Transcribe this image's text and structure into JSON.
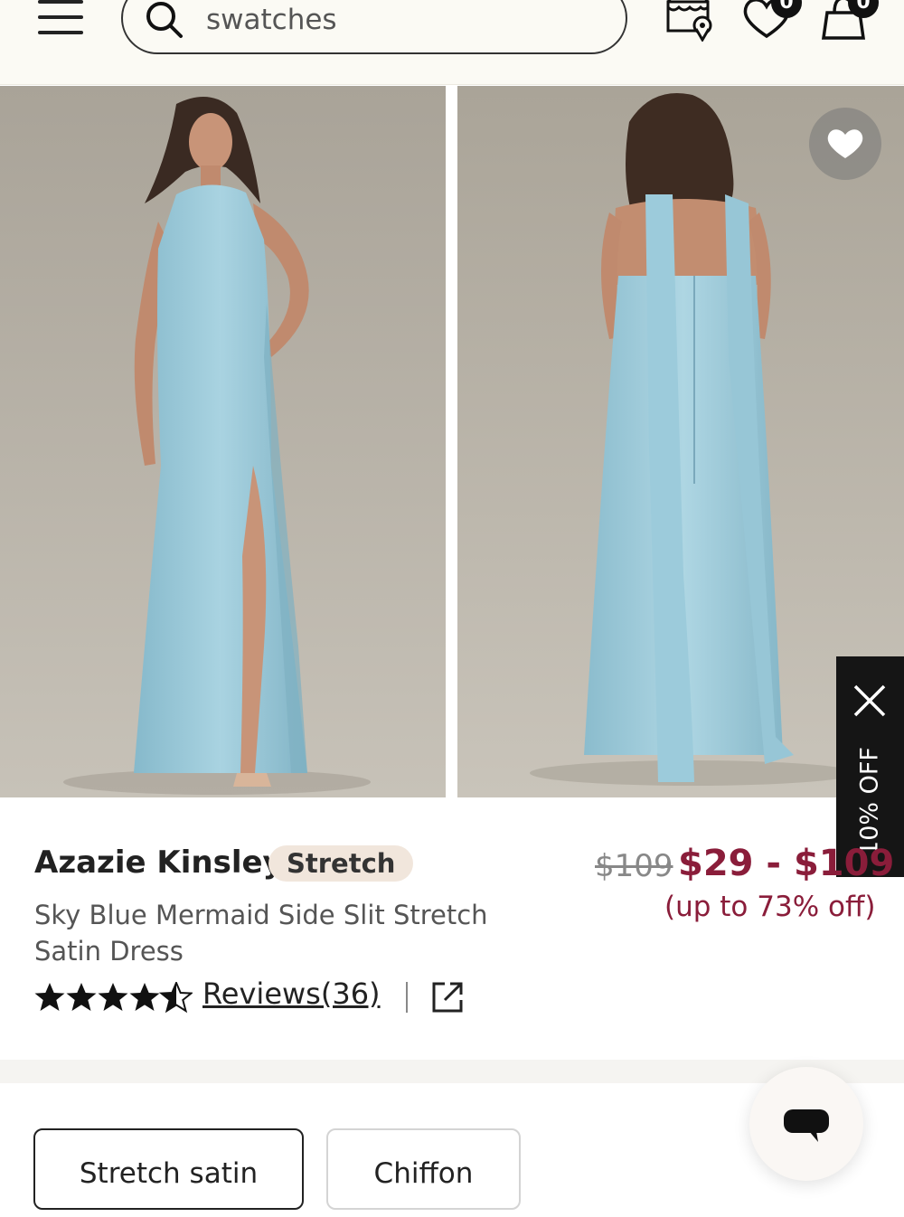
{
  "header": {
    "search_placeholder": "swatches",
    "wishlist_count": "0",
    "cart_count": "0",
    "icons": [
      "menu-icon",
      "search-icon",
      "store-locator-icon",
      "heart-icon",
      "bag-icon"
    ]
  },
  "gallery": {
    "images": [
      {
        "alt": "Front view of sky blue halter satin dress"
      },
      {
        "alt": "Back view of sky blue dress with scarf"
      }
    ]
  },
  "promo": {
    "label": "10% OFF"
  },
  "product": {
    "name": "Azazie Kinsley",
    "tag": "Stretch",
    "description": "Sky Blue Mermaid Side Slit Stretch Satin Dress",
    "original_price": "$109",
    "price_range": "$29 - $109",
    "discount": "(up to 73% off)",
    "rating": 4.5,
    "reviews_label": "Reviews(36)"
  },
  "fabric_options": [
    "Stretch satin",
    "Chiffon"
  ],
  "colors": {
    "accent": "#8a1d3a",
    "dress": "#9ccbdb",
    "background": "#b6b0a5"
  }
}
